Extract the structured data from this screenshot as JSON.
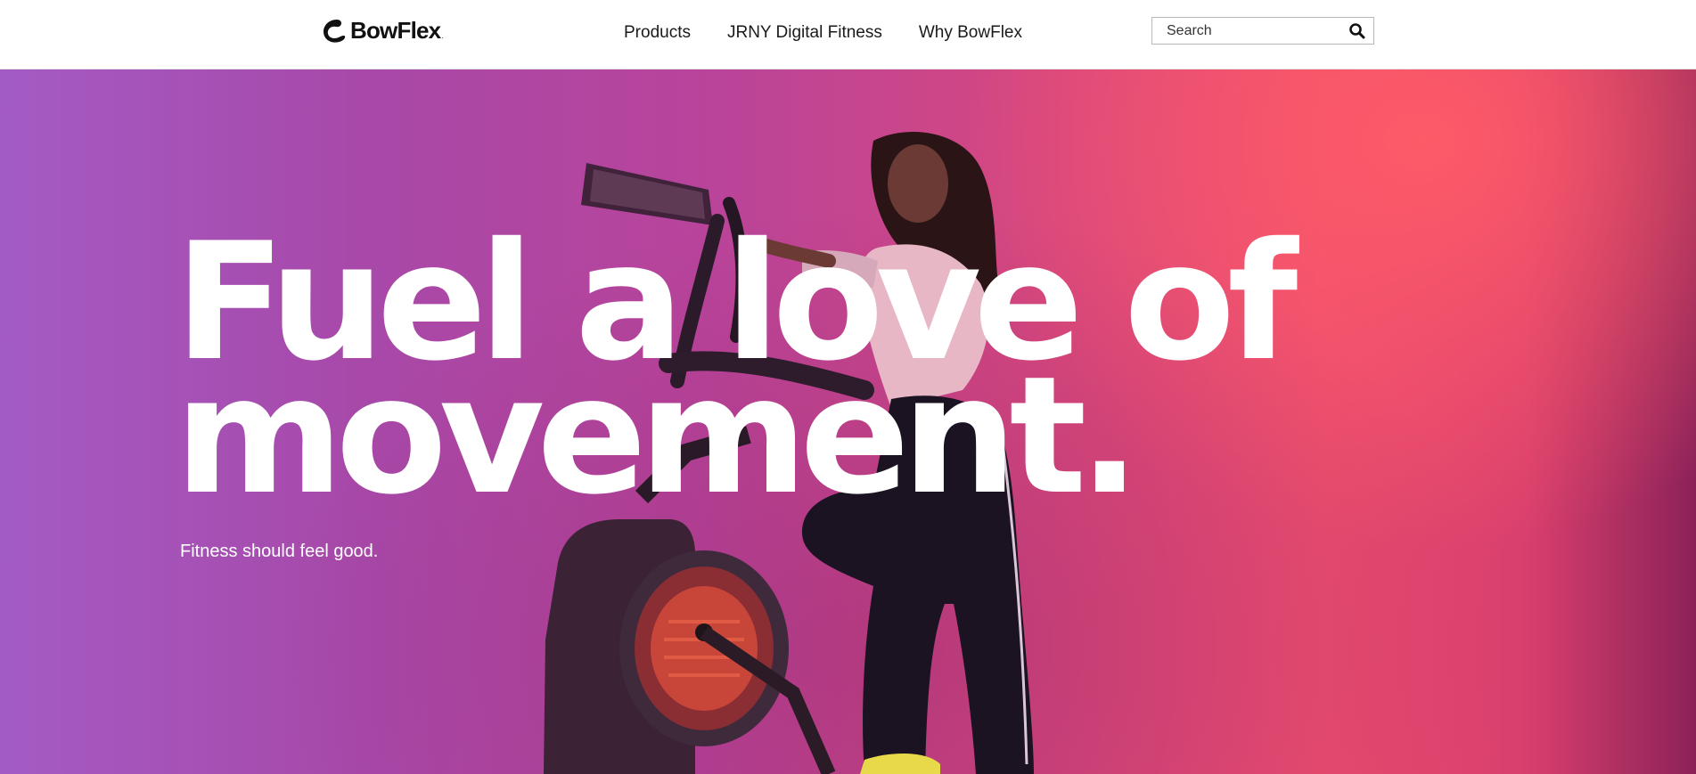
{
  "header": {
    "logo": {
      "text": "BowFlex",
      "trademark": ".",
      "icon": "bowflex-logo-mark"
    },
    "nav": [
      {
        "label": "Products"
      },
      {
        "label": "JRNY Digital Fitness"
      },
      {
        "label": "Why BowFlex"
      }
    ],
    "search": {
      "placeholder": "Search",
      "value": "",
      "icon": "search-icon"
    }
  },
  "hero": {
    "headline_line1": "Fuel a love of",
    "headline_line2": "movement.",
    "subtitle": "Fitness should feel good.",
    "image": "woman-on-bowflex-max-trainer",
    "colors": {
      "gradient_left": "#a35bc4",
      "gradient_mid": "#b9449a",
      "gradient_right": "#ea4c6f",
      "glow": "#ff5c68",
      "text": "#ffffff"
    }
  }
}
